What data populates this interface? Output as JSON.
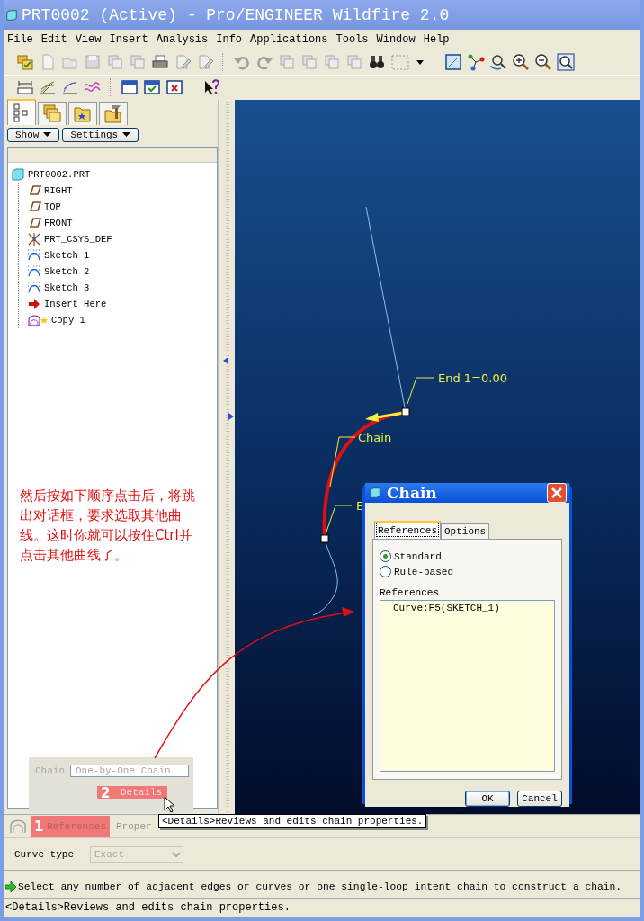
{
  "window": {
    "title": "PRT0002 (Active) - Pro/ENGINEER Wildfire 2.0"
  },
  "menu": [
    "File",
    "Edit",
    "View",
    "Insert",
    "Analysis",
    "Info",
    "Applications",
    "Tools",
    "Window",
    "Help"
  ],
  "model_tree": {
    "tabs": [
      {
        "kind": "tree",
        "selected": true
      },
      {
        "kind": "layers",
        "selected": false
      },
      {
        "kind": "folder",
        "selected": false
      },
      {
        "kind": "tools",
        "selected": false
      }
    ],
    "buttons": [
      "Show",
      "Settings"
    ],
    "items": [
      {
        "label": "PRT0002.PRT",
        "kind": "part",
        "children": [
          {
            "label": "RIGHT",
            "kind": "plane"
          },
          {
            "label": "TOP",
            "kind": "plane"
          },
          {
            "label": "FRONT",
            "kind": "plane"
          },
          {
            "label": "PRT_CSYS_DEF",
            "kind": "csys"
          },
          {
            "label": "Sketch 1",
            "kind": "sketch"
          },
          {
            "label": "Sketch 2",
            "kind": "sketch"
          },
          {
            "label": "Sketch 3",
            "kind": "sketch"
          },
          {
            "label": "Insert Here",
            "kind": "insert"
          },
          {
            "label": "Copy 1",
            "kind": "copy"
          }
        ]
      }
    ]
  },
  "canvas": {
    "labels": [
      "End 1=0.00",
      "Chain",
      "E"
    ]
  },
  "annotation": {
    "lines": [
      "然后按如下顺序点击后，将跳",
      "出对话框，要求选取其他曲",
      "线。这时你就可以按住Ctrl并",
      "点击其他曲线了。"
    ]
  },
  "dashboard": {
    "chain_label": "Chain",
    "chain_value": "One-by-One Chain",
    "details_button": "Details",
    "details_marker": "2",
    "tabs": [
      {
        "label": "References",
        "selected": true,
        "marker": "1"
      },
      {
        "label": "Proper",
        "selected": false
      }
    ]
  },
  "tooltip": "<Details>Reviews and edits chain properties.",
  "curve_type": {
    "label": "Curve type",
    "value": "Exact",
    "disabled": true
  },
  "dialog": {
    "title": "Chain",
    "tabs": [
      {
        "label": "References",
        "selected": true
      },
      {
        "label": "Options",
        "selected": false
      }
    ],
    "radios": [
      {
        "label": "Standard",
        "selected": true
      },
      {
        "label": "Rule-based",
        "selected": false
      }
    ],
    "list_label": "References",
    "list_items": [
      "Curve:F5(SKETCH_1)"
    ],
    "buttons": [
      "OK",
      "Cancel"
    ]
  },
  "message": "Select any number of adjacent edges or curves or one single-loop intent chain to construct a chain.",
  "status": "<Details>Reviews and edits chain properties."
}
